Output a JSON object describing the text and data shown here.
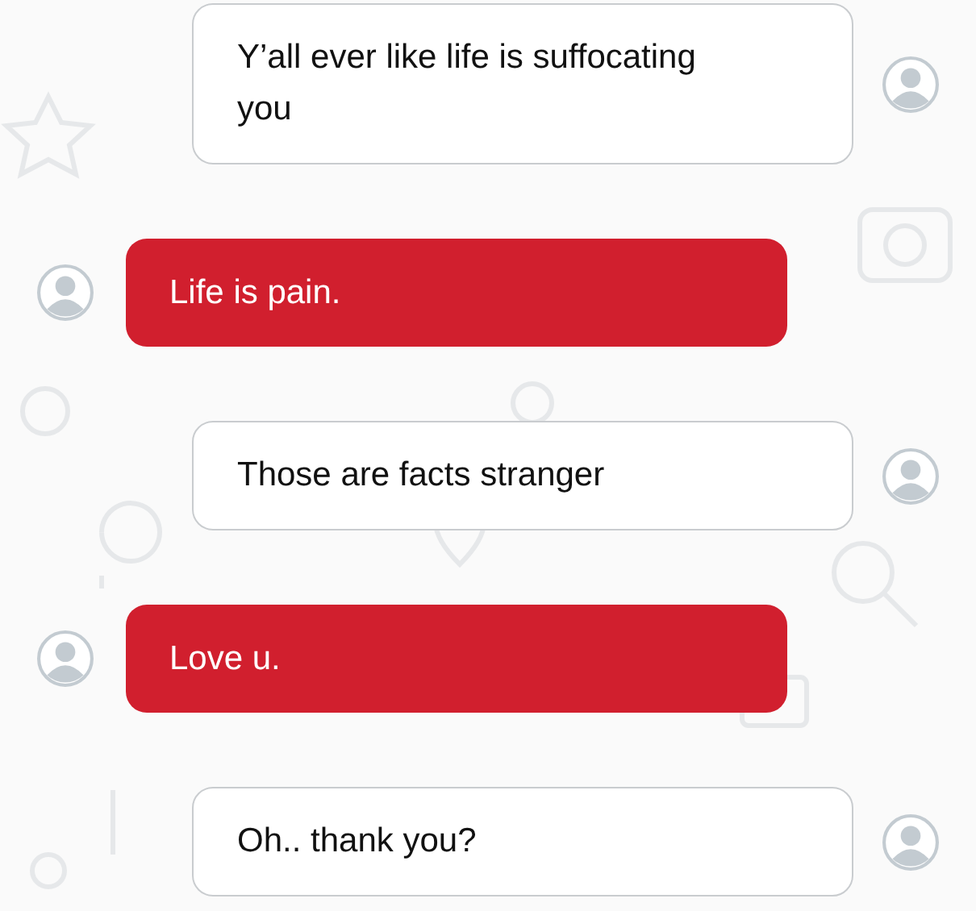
{
  "messages": [
    {
      "kind": "outgoing",
      "text": "Y’all ever like life is suffocating you"
    },
    {
      "kind": "incoming",
      "text": "Life is pain."
    },
    {
      "kind": "outgoing",
      "text": "Those are facts stranger"
    },
    {
      "kind": "incoming",
      "text": "Love u."
    },
    {
      "kind": "outgoing",
      "text": "Oh.. thank you?"
    }
  ]
}
